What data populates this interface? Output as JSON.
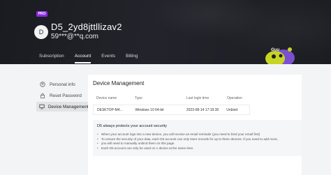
{
  "header": {
    "badge": "PRO",
    "avatar_initial": "D",
    "username": "D5_2yd8jttllizav2",
    "email": "59***@**q.com",
    "mascot_text": "Guu",
    "tabs": [
      {
        "label": "Subscription",
        "active": false
      },
      {
        "label": "Account",
        "active": true
      },
      {
        "label": "Events",
        "active": false
      },
      {
        "label": "Billing",
        "active": false
      }
    ]
  },
  "sidebar": {
    "items": [
      {
        "label": "Personal info",
        "icon": "person-icon",
        "active": false
      },
      {
        "label": "Reset Password",
        "icon": "lock-icon",
        "active": false
      },
      {
        "label": "Device Management",
        "icon": "monitor-icon",
        "active": true
      }
    ]
  },
  "device_management": {
    "title": "Device Management",
    "columns": [
      "Device name",
      "Type",
      "Last login time",
      "Operation"
    ],
    "rows": [
      {
        "name": "DESKTOP-M4...",
        "type": "Windows 10 64-bit",
        "last_login": "2023-08-14 17:19:30",
        "operation": "Unbind"
      }
    ]
  },
  "notice": {
    "title": "D5 always protects your account security",
    "items": [
      "When your account logs into a new device, you will receive an email reminder (you need to bind your email first)",
      "To ensure the security of your data, each D5 account can only store records for up to three devices. If you need to add more,",
      "you will need to manually unbind them on this page.",
      "Each D5 account can only be used on 1 device at the same time."
    ]
  },
  "colors": {
    "hero_bg": "#1f2026",
    "pro_badge": "#8d29e6",
    "page_bg": "#f3f4f6",
    "panel_bg": "#ffffff",
    "mascot_yellow": "#c7d421",
    "mascot_purple": "#7a4fd1"
  }
}
